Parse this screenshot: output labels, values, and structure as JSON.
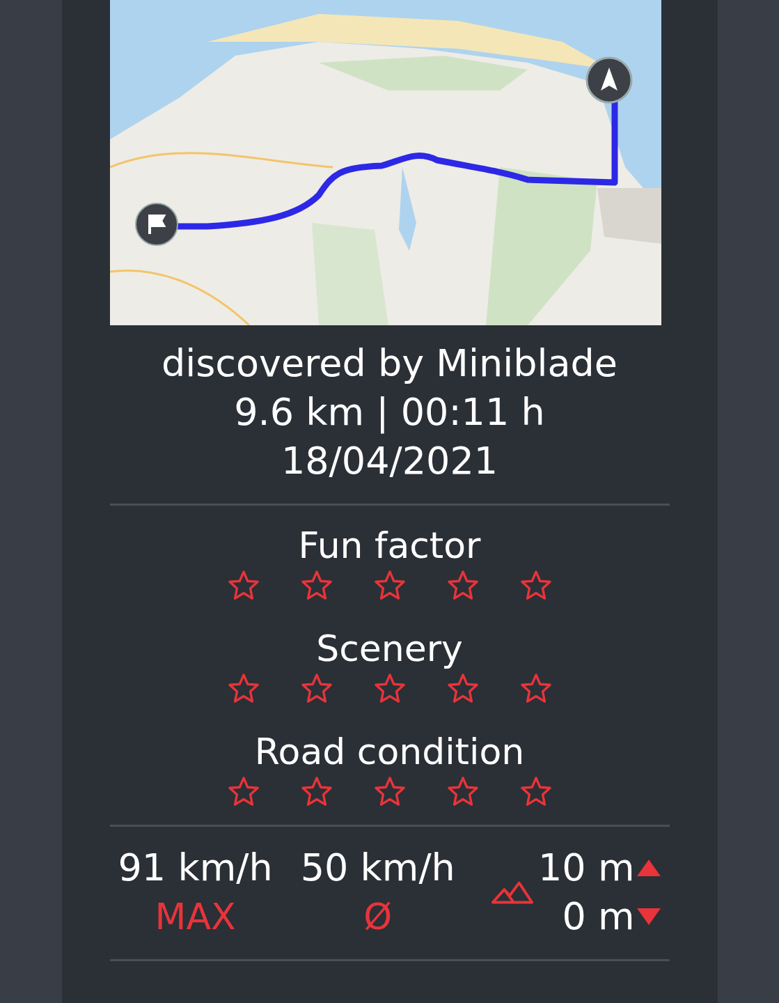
{
  "route": {
    "author_line": "discovered by Miniblade",
    "summary": "9.6 km | 00:11 h",
    "date": "18/04/2021"
  },
  "ratings": [
    {
      "label": "Fun factor",
      "stars": 0
    },
    {
      "label": "Scenery",
      "stars": 0
    },
    {
      "label": "Road condition",
      "stars": 0
    }
  ],
  "stats": [
    {
      "value": "91 km/h",
      "label": "MAX"
    },
    {
      "value": "50 km/h",
      "label": "Ø"
    }
  ],
  "elevation": {
    "ascent": "10 m",
    "descent": "0 m"
  }
}
